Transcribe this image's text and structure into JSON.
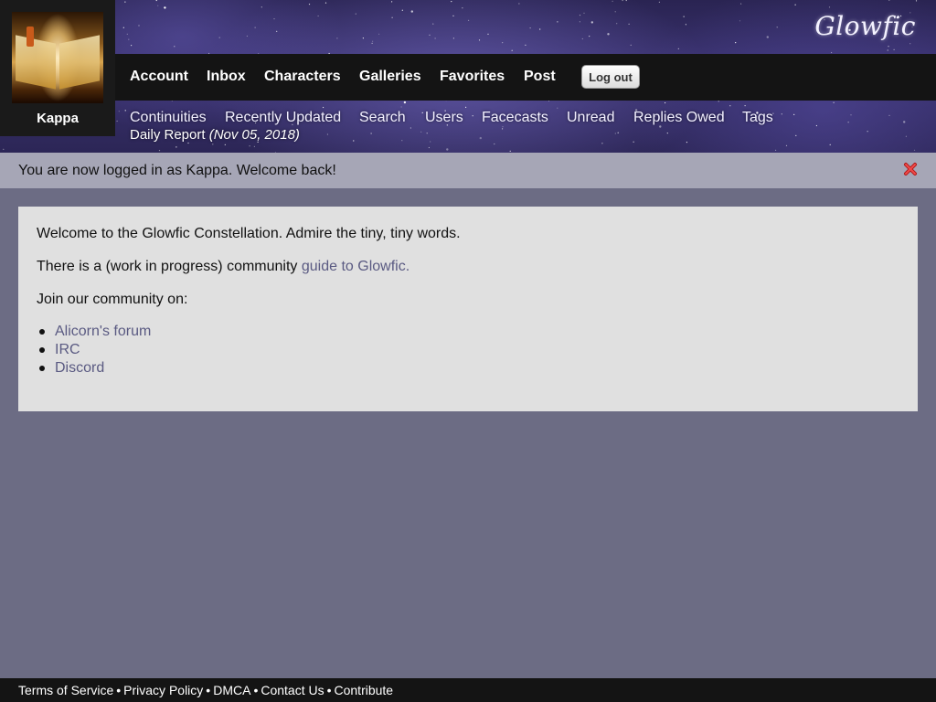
{
  "site": {
    "logo": "Glowfic"
  },
  "user": {
    "name": "Kappa"
  },
  "nav": {
    "primary": [
      "Account",
      "Inbox",
      "Characters",
      "Galleries",
      "Favorites",
      "Post"
    ],
    "logout_label": "Log out",
    "secondary": [
      "Continuities",
      "Recently Updated",
      "Search",
      "Users",
      "Facecasts",
      "Unread",
      "Replies Owed",
      "Tags"
    ],
    "daily_report": {
      "label": "Daily Report",
      "date": "(Nov 05, 2018)"
    }
  },
  "flash": {
    "message": "You are now logged in as Kappa. Welcome back!"
  },
  "content": {
    "welcome": "Welcome to the Glowfic Constellation. Admire the tiny, tiny words.",
    "guide_prefix": "There is a (work in progress) community",
    "guide_link": "guide to Glowfic.",
    "community_intro": "Join our community on:",
    "community_links": [
      "Alicorn's forum",
      "IRC",
      "Discord"
    ]
  },
  "footer": {
    "links": [
      "Terms of Service",
      "Privacy Policy",
      "DMCA",
      "Contact Us",
      "Contribute"
    ],
    "separator": "•"
  },
  "colors": {
    "nav_bar": "#141414",
    "flash_bg": "#a6a6b6",
    "content_bg": "#e0e0e0",
    "page_bg": "#6c6c84",
    "link": "#5a5a82",
    "close_icon": "#e03030"
  },
  "icons": {
    "flash_close": "close-icon"
  }
}
